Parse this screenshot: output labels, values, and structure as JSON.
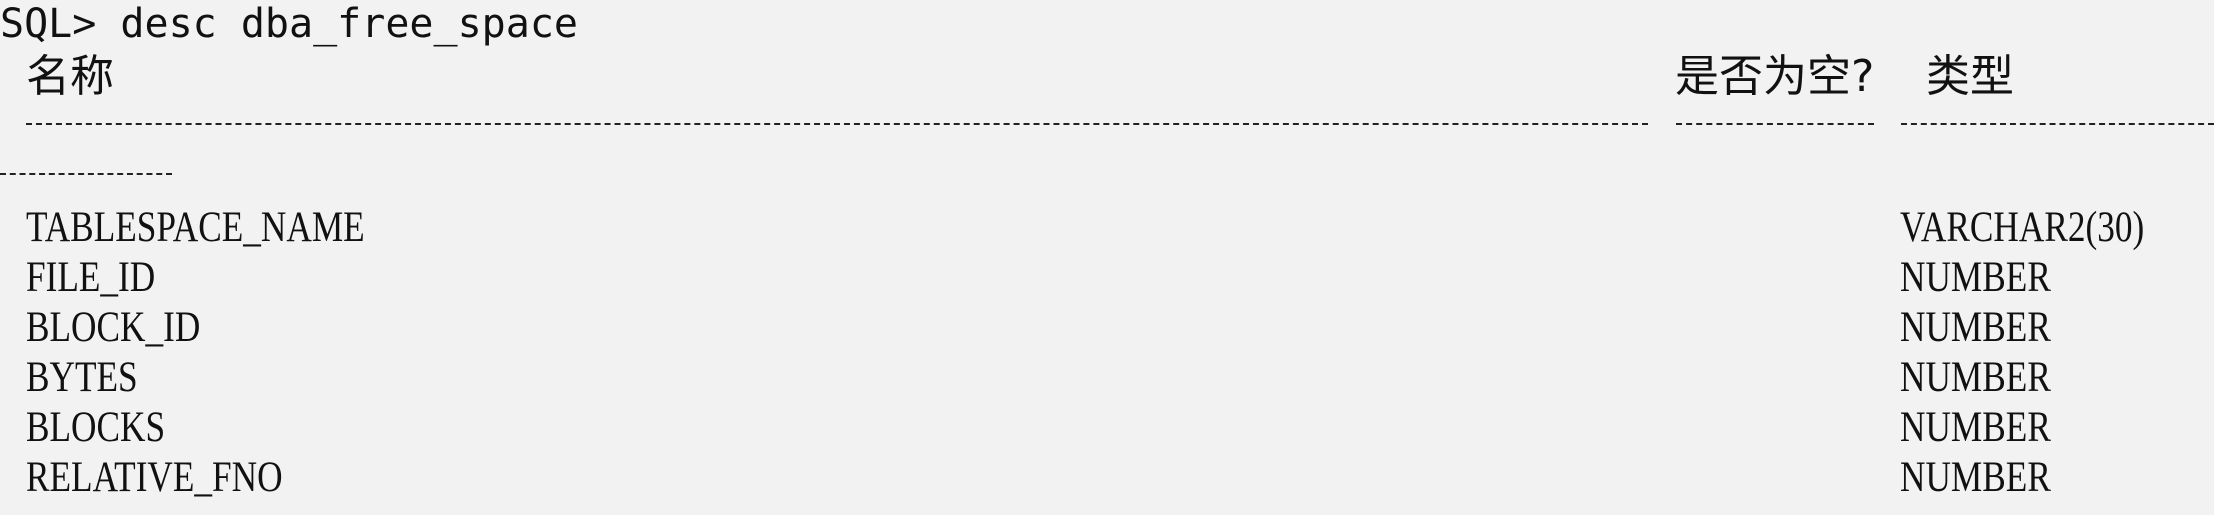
{
  "terminal": {
    "prompt": "SQL>",
    "command": "desc dba_free_space",
    "header": {
      "name": "名称",
      "nullable": "是否为空?",
      "type": "类型"
    },
    "rows": [
      {
        "name": "TABLESPACE_NAME",
        "type": "VARCHAR2(30)"
      },
      {
        "name": "FILE_ID",
        "type": "NUMBER"
      },
      {
        "name": "BLOCK_ID",
        "type": "NUMBER"
      },
      {
        "name": "BYTES",
        "type": "NUMBER"
      },
      {
        "name": "BLOCKS",
        "type": "NUMBER"
      },
      {
        "name": "RELATIVE_FNO",
        "type": "NUMBER"
      }
    ]
  }
}
